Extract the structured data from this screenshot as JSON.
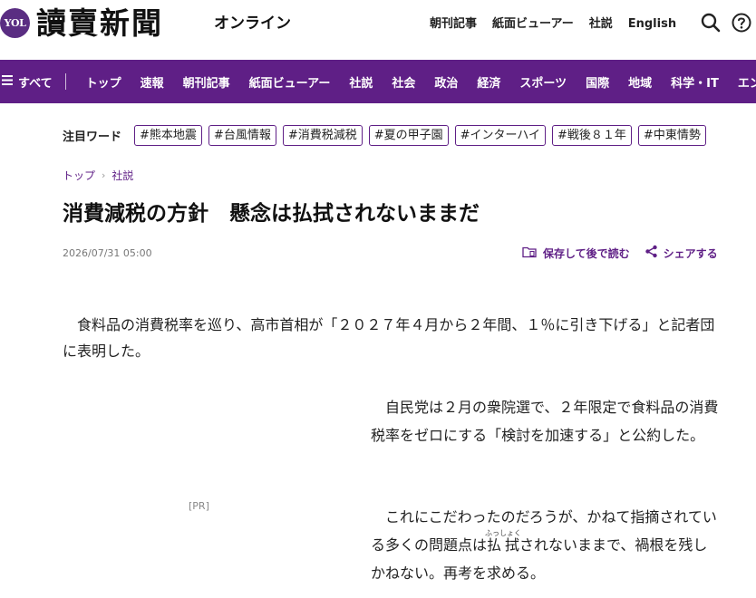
{
  "header": {
    "badge": "YOL",
    "brand": "讀賣新聞",
    "brand_sub": "オンライン",
    "links": [
      "朝刊記事",
      "紙面ビューアー",
      "社説",
      "English"
    ]
  },
  "nav": {
    "all_label": "すべて",
    "items": [
      "トップ",
      "速報",
      "朝刊記事",
      "紙面ビューアー",
      "社説",
      "社会",
      "政治",
      "経済",
      "スポーツ",
      "国際",
      "地域",
      "科学・IT",
      "エンタ"
    ]
  },
  "trending": {
    "label": "注目ワード",
    "tags": [
      "#熊本地震",
      "#台風情報",
      "#消費税減税",
      "#夏の甲子園",
      "#インターハイ",
      "#戦後８１年",
      "#中東情勢"
    ]
  },
  "breadcrumb": {
    "items": [
      "トップ",
      "社説"
    ]
  },
  "article": {
    "title": "消費減税の方針　懸念は払拭されないままだ",
    "date": "2026/07/31 05:00",
    "save_label": "保存して後で読む",
    "share_label": "シェアする",
    "para1": "食料品の消費税率を巡り、高市首相が「２０２７年４月から２年間、１％に引き下げる」と記者団に表明した。",
    "pr_label": "[PR]",
    "para2": "自民党は２月の衆院選で、２年限定で食料品の消費税率をゼロにする「検討を加速する」と公約した。",
    "para3_before": "これにこだわったのだろうが、かねて指摘されている多くの問題点は",
    "para3_ruby_base": "払拭",
    "para3_ruby_text": "ふっしょく",
    "para3_after": "されないままで、禍根を残しかねない。再考を求める。"
  },
  "colors": {
    "brand_purple": "#5f1f86",
    "badge_purple": "#5a2d82"
  },
  "icons": {
    "search": "search-icon",
    "help": "help-icon",
    "menu": "menu-icon",
    "save": "bookmark-folder-icon",
    "share": "share-icon"
  }
}
